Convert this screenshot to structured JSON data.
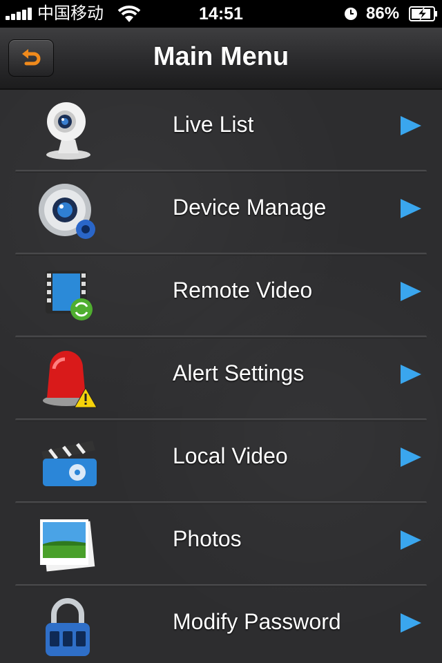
{
  "status_bar": {
    "carrier": "中国移动",
    "time": "14:51",
    "battery": "86%"
  },
  "nav": {
    "title": "Main Menu",
    "back_icon": "back-arrow-icon"
  },
  "menu": {
    "items": [
      {
        "label": "Live List",
        "icon": "webcam-icon"
      },
      {
        "label": "Device Manage",
        "icon": "camera-gear-icon"
      },
      {
        "label": "Remote Video",
        "icon": "film-sync-icon"
      },
      {
        "label": "Alert Settings",
        "icon": "alarm-siren-icon"
      },
      {
        "label": "Local Video",
        "icon": "clapperboard-icon"
      },
      {
        "label": "Photos",
        "icon": "photos-icon"
      },
      {
        "label": "Modify Password",
        "icon": "padlock-icon"
      }
    ]
  },
  "colors": {
    "background": "#2d2d2f",
    "chevron": "#3aa6ee",
    "back_arrow": "#f08a1c"
  }
}
